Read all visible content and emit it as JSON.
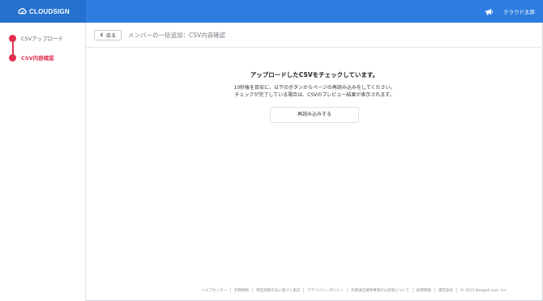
{
  "brand": {
    "name": "CLOUDSIGN"
  },
  "header": {
    "user_name": "クラウド太郎"
  },
  "sidebar": {
    "steps": [
      {
        "label": "CSVアップロード",
        "active": false
      },
      {
        "label": "CSV内容確認",
        "active": true
      }
    ]
  },
  "main": {
    "back_label": "戻る",
    "title": "メンバーの一括追加：CSV内容確認",
    "heading": "アップロードしたCSVをチェックしています。",
    "desc_line1": "10秒後を目安に、以下のボタンからページの再読み込みをしてください。",
    "desc_line2": "チェックが完了している場合は、CSVのプレビュー結果が表示されます。",
    "reload_label": "再読み込みする"
  },
  "footer": {
    "links": [
      "ヘルプセンター",
      "利用規約",
      "特定商取引法に基づく表記",
      "プライバシーポリシー",
      "外部送信規律事項の公表等について",
      "採用情報",
      "運営会社"
    ],
    "copyright": "© 2015 Bengo4.com, Inc."
  },
  "colors": {
    "accent": "#2d7ee0",
    "brand_bg": "#2571cf",
    "step": "#e02f4f"
  }
}
